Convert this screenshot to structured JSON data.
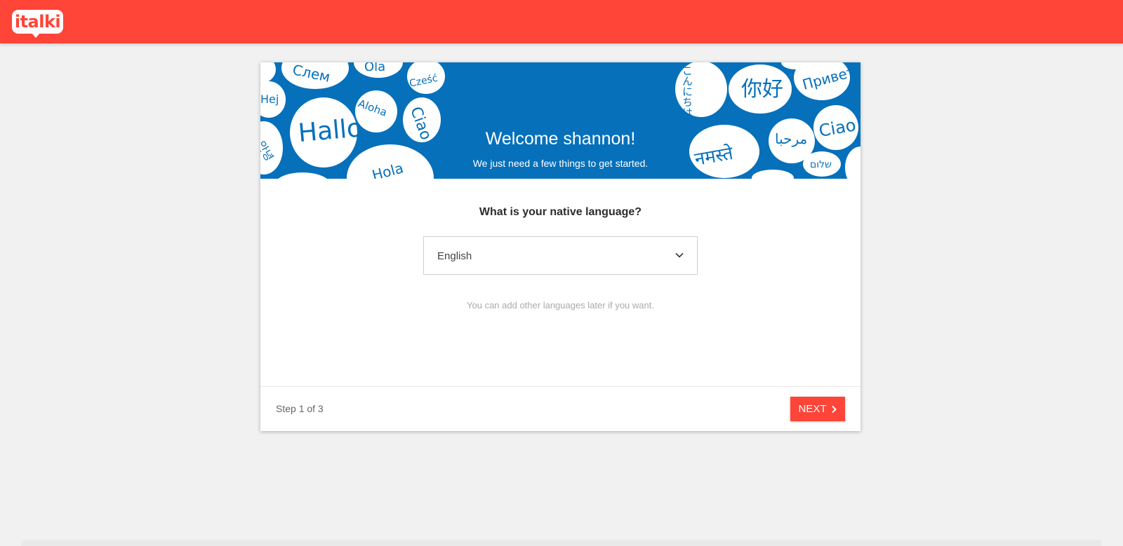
{
  "brand": {
    "name": "italki",
    "color": "#ff4438"
  },
  "banner": {
    "title": "Welcome shannon!",
    "subtitle": "We just need a few things to get started.",
    "background_color": "#0670ba",
    "greetings": [
      "Слем",
      "Ola",
      "Cześć",
      "Hej",
      "Aloha",
      "Ciao",
      "Hallo",
      "안녕",
      "Hola",
      "こんにちは",
      "你好",
      "Привет",
      "Ciao",
      "नमस्ते",
      "مرحبا",
      "שלום"
    ]
  },
  "form": {
    "question": "What is your native language?",
    "language_select": {
      "value": "English"
    },
    "hint": "You can add other languages later if you want."
  },
  "footer": {
    "step": "Step 1 of 3",
    "next_label": "NEXT"
  }
}
